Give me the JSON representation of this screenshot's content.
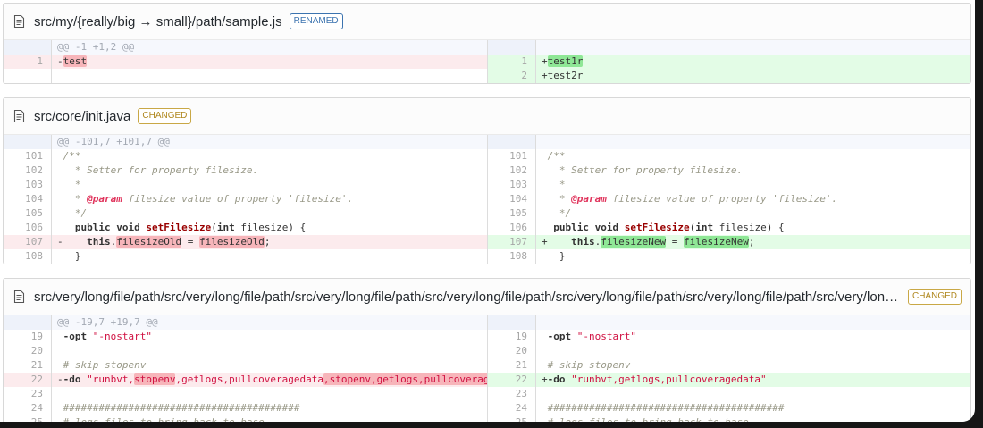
{
  "colors": {
    "renamed_badge": "#3b73af",
    "changed_badge": "#b08820",
    "deletion_line_bg": "#fcebed",
    "deletion_word_bg": "#f7b5ba",
    "insertion_line_bg": "#e3fce6",
    "insertion_word_bg": "#8fe796",
    "hunk_header_bg": "#f6f8fd"
  },
  "files": [
    {
      "name": "src/my/{really/big → small}/path/sample.js",
      "badge": {
        "label": "RENAMED",
        "type": "renamed"
      },
      "left": [
        {
          "type": "info",
          "text": "@@ -1 +1,2 @@"
        },
        {
          "type": "del",
          "num": "1",
          "segs": [
            [
              "-",
              ""
            ],
            [
              "test",
              "hl"
            ]
          ]
        },
        {
          "type": "empty"
        }
      ],
      "right": [
        {
          "type": "info",
          "text": ""
        },
        {
          "type": "ins",
          "num": "1",
          "segs": [
            [
              "+",
              ""
            ],
            [
              "test1r",
              "hl"
            ]
          ]
        },
        {
          "type": "ins",
          "num": "2",
          "segs": [
            [
              "+",
              ""
            ],
            [
              "test2r",
              ""
            ]
          ]
        }
      ]
    },
    {
      "name": "src/core/init.java",
      "badge": {
        "label": "CHANGED",
        "type": "changed"
      },
      "left": [
        {
          "type": "info",
          "text": "@@ -101,7 +101,7 @@"
        },
        {
          "type": "ctx",
          "num": "101",
          "segs": [
            [
              " ",
              ""
            ],
            [
              "/**",
              "cmt"
            ]
          ]
        },
        {
          "type": "ctx",
          "num": "102",
          "segs": [
            [
              " ",
              ""
            ],
            [
              "  * Setter for property filesize.",
              "cmt"
            ]
          ]
        },
        {
          "type": "ctx",
          "num": "103",
          "segs": [
            [
              " ",
              ""
            ],
            [
              "  *",
              "cmt"
            ]
          ]
        },
        {
          "type": "ctx",
          "num": "104",
          "segs": [
            [
              " ",
              ""
            ],
            [
              "  * ",
              "cmt"
            ],
            [
              "@param",
              "ann"
            ],
            [
              " filesize value of property 'filesize'.",
              "cmt"
            ]
          ]
        },
        {
          "type": "ctx",
          "num": "105",
          "segs": [
            [
              " ",
              ""
            ],
            [
              "  */",
              "cmt"
            ]
          ]
        },
        {
          "type": "ctx",
          "num": "106",
          "segs": [
            [
              "   ",
              ""
            ],
            [
              "public",
              "kw"
            ],
            [
              " ",
              ""
            ],
            [
              "void",
              "kw"
            ],
            [
              " ",
              ""
            ],
            [
              "setFilesize",
              "fn"
            ],
            [
              "(",
              ""
            ],
            [
              "int",
              "kw"
            ],
            [
              " filesize) {",
              ""
            ]
          ]
        },
        {
          "type": "del",
          "num": "107",
          "segs": [
            [
              "-",
              ""
            ],
            [
              "    ",
              ""
            ],
            [
              "this",
              "kw"
            ],
            [
              ".",
              ""
            ],
            [
              "filesizeOld",
              "hl"
            ],
            [
              " = ",
              ""
            ],
            [
              "filesizeOld",
              "hl"
            ],
            [
              ";",
              ""
            ]
          ]
        },
        {
          "type": "ctx",
          "num": "108",
          "segs": [
            [
              " ",
              ""
            ],
            [
              "  }",
              ""
            ]
          ]
        }
      ],
      "right": [
        {
          "type": "info",
          "text": ""
        },
        {
          "type": "ctx",
          "num": "101",
          "segs": [
            [
              " ",
              ""
            ],
            [
              "/**",
              "cmt"
            ]
          ]
        },
        {
          "type": "ctx",
          "num": "102",
          "segs": [
            [
              " ",
              ""
            ],
            [
              "  * Setter for property filesize.",
              "cmt"
            ]
          ]
        },
        {
          "type": "ctx",
          "num": "103",
          "segs": [
            [
              " ",
              ""
            ],
            [
              "  *",
              "cmt"
            ]
          ]
        },
        {
          "type": "ctx",
          "num": "104",
          "segs": [
            [
              " ",
              ""
            ],
            [
              "  * ",
              "cmt"
            ],
            [
              "@param",
              "ann"
            ],
            [
              " filesize value of property 'filesize'.",
              "cmt"
            ]
          ]
        },
        {
          "type": "ctx",
          "num": "105",
          "segs": [
            [
              " ",
              ""
            ],
            [
              "  */",
              "cmt"
            ]
          ]
        },
        {
          "type": "ctx",
          "num": "106",
          "segs": [
            [
              "  ",
              ""
            ],
            [
              "public",
              "kw"
            ],
            [
              " ",
              ""
            ],
            [
              "void",
              "kw"
            ],
            [
              " ",
              ""
            ],
            [
              "setFilesize",
              "fn"
            ],
            [
              "(",
              ""
            ],
            [
              "int",
              "kw"
            ],
            [
              " filesize) {",
              ""
            ]
          ]
        },
        {
          "type": "ins",
          "num": "107",
          "segs": [
            [
              "+",
              ""
            ],
            [
              "    ",
              ""
            ],
            [
              "this",
              "kw"
            ],
            [
              ".",
              ""
            ],
            [
              "filesizeNew",
              "hl"
            ],
            [
              " = ",
              ""
            ],
            [
              "filesizeNew",
              "hl"
            ],
            [
              ";",
              ""
            ]
          ]
        },
        {
          "type": "ctx",
          "num": "108",
          "segs": [
            [
              " ",
              ""
            ],
            [
              "  }",
              ""
            ]
          ]
        }
      ]
    },
    {
      "name": "src/very/long/file/path/src/very/long/file/path/src/very/long/file/path/src/very/long/file/path/src/very/long/file/path/src/very/long/file/path/src/very/long/file/path/src/very/long/file/path/src/very/long/file/path",
      "badge": {
        "label": "CHANGED",
        "type": "changed"
      },
      "left": [
        {
          "type": "info",
          "text": "@@ -19,7 +19,7 @@"
        },
        {
          "type": "ctx",
          "num": "19",
          "segs": [
            [
              " ",
              ""
            ],
            [
              "-opt",
              "kw"
            ],
            [
              " ",
              ""
            ],
            [
              "\"-nostart\"",
              "str"
            ]
          ]
        },
        {
          "type": "ctx",
          "num": "20",
          "segs": [
            [
              " ",
              ""
            ]
          ]
        },
        {
          "type": "ctx",
          "num": "21",
          "segs": [
            [
              " ",
              ""
            ],
            [
              "# skip stopenv",
              "cmt"
            ]
          ]
        },
        {
          "type": "del",
          "num": "22",
          "segs": [
            [
              "-",
              ""
            ],
            [
              "-do",
              "kw"
            ],
            [
              " ",
              ""
            ],
            [
              "\"runbvt,",
              "str"
            ],
            [
              "stopenv",
              "str hl"
            ],
            [
              ",getlogs,pullcoveragedata",
              "str"
            ],
            [
              ",stopenv,getlogs,pullcoveragedata",
              "str hl"
            ],
            [
              "\"",
              "str"
            ]
          ]
        },
        {
          "type": "ctx",
          "num": "23",
          "segs": [
            [
              " ",
              ""
            ]
          ]
        },
        {
          "type": "ctx",
          "num": "24",
          "segs": [
            [
              " ",
              ""
            ],
            [
              "########################################",
              "cmt"
            ]
          ]
        },
        {
          "type": "ctx",
          "num": "25",
          "segs": [
            [
              " ",
              ""
            ],
            [
              "# logs files to bring back to base",
              "cmt"
            ]
          ]
        }
      ],
      "right": [
        {
          "type": "info",
          "text": ""
        },
        {
          "type": "ctx",
          "num": "19",
          "segs": [
            [
              " ",
              ""
            ],
            [
              "-opt",
              "kw"
            ],
            [
              " ",
              ""
            ],
            [
              "\"-nostart\"",
              "str"
            ]
          ]
        },
        {
          "type": "ctx",
          "num": "20",
          "segs": [
            [
              " ",
              ""
            ]
          ]
        },
        {
          "type": "ctx",
          "num": "21",
          "segs": [
            [
              " ",
              ""
            ],
            [
              "# skip stopenv",
              "cmt"
            ]
          ]
        },
        {
          "type": "ins",
          "num": "22",
          "segs": [
            [
              "+",
              ""
            ],
            [
              "-do",
              "kw"
            ],
            [
              " ",
              ""
            ],
            [
              "\"runbvt,getlogs,pullcoveragedata\"",
              "str"
            ]
          ]
        },
        {
          "type": "ctx",
          "num": "23",
          "segs": [
            [
              " ",
              ""
            ]
          ]
        },
        {
          "type": "ctx",
          "num": "24",
          "segs": [
            [
              " ",
              ""
            ],
            [
              "########################################",
              "cmt"
            ]
          ]
        },
        {
          "type": "ctx",
          "num": "25",
          "segs": [
            [
              " ",
              ""
            ],
            [
              "# logs files to bring back to base",
              "cmt"
            ]
          ]
        }
      ]
    }
  ]
}
